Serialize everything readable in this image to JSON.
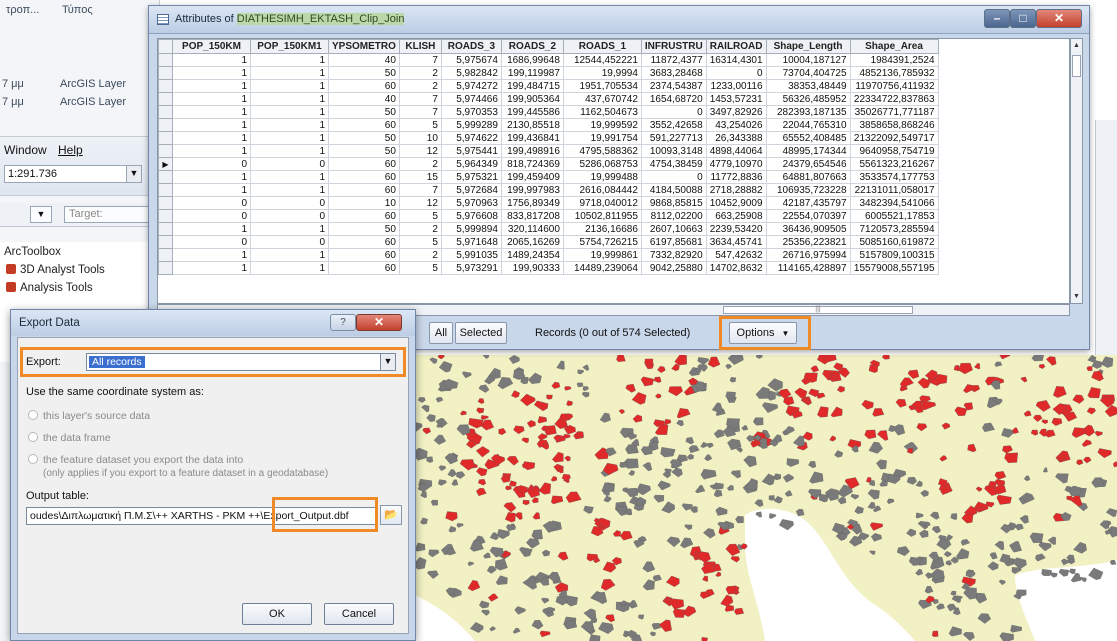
{
  "background_window": {
    "column_headers": [
      "τροπ...",
      "Τύπος"
    ],
    "layers": [
      {
        "size": "7 μμ",
        "type": "ArcGIS Layer"
      },
      {
        "size": "7 μμ",
        "type": "ArcGIS Layer"
      }
    ],
    "menu": {
      "window": "Window",
      "help": "Help"
    },
    "scale": "1:291.736",
    "target_label": "Target:",
    "arctoolbox": {
      "title": "ArcToolbox",
      "items": [
        "3D Analyst Tools",
        "Analysis Tools"
      ]
    }
  },
  "attribute_table": {
    "title_prefix": "Attributes of ",
    "title_highlight": "DIATHESIMH_EKTASH_Clip_Join",
    "columns": [
      "POP_150KM",
      "POP_150KM1",
      "YPSOMETRO",
      "KLISH",
      "ROADS_3",
      "ROADS_2",
      "ROADS_1",
      "INFRUSTRU",
      "RAILROAD",
      "Shape_Length",
      "Shape_Area"
    ],
    "rows": [
      [
        "1",
        "1",
        "40",
        "7",
        "5,975674",
        "1686,99648",
        "12544,452221",
        "11872,4377",
        "16314,4301",
        "10004,187127",
        "1984391,2524"
      ],
      [
        "1",
        "1",
        "50",
        "2",
        "5,982842",
        "199,119987",
        "19,9994",
        "3683,28468",
        "0",
        "73704,404725",
        "4852136,785932"
      ],
      [
        "1",
        "1",
        "60",
        "2",
        "5,974272",
        "199,484715",
        "1951,705534",
        "2374,54387",
        "1233,00116",
        "38353,48449",
        "11970756,411932"
      ],
      [
        "1",
        "1",
        "40",
        "7",
        "5,974466",
        "199,905364",
        "437,670742",
        "1654,68720",
        "1453,57231",
        "56326,485952",
        "22334722,837863"
      ],
      [
        "1",
        "1",
        "50",
        "7",
        "5,970353",
        "199,445586",
        "1162,504673",
        "0",
        "3497,82926",
        "282393,187135",
        "35026771,771187"
      ],
      [
        "1",
        "1",
        "60",
        "5",
        "5,999289",
        "2130,85518",
        "19,999592",
        "3552,42658",
        "43,254026",
        "22044,765310",
        "3858658,868246"
      ],
      [
        "1",
        "1",
        "50",
        "10",
        "5,974622",
        "199,436841",
        "19,991754",
        "591,227713",
        "26,343388",
        "65552,408485",
        "21322092,549717"
      ],
      [
        "1",
        "1",
        "50",
        "12",
        "5,975441",
        "199,498916",
        "4795,588362",
        "10093,3148",
        "4898,44064",
        "48995,174344",
        "9640958,754719"
      ],
      [
        "0",
        "0",
        "60",
        "2",
        "5,964349",
        "818,724369",
        "5286,068753",
        "4754,38459",
        "4779,10970",
        "24379,654546",
        "5561323,216267"
      ],
      [
        "1",
        "1",
        "60",
        "15",
        "5,975321",
        "199,459409",
        "19,999488",
        "0",
        "11772,8836",
        "64881,807663",
        "3533574,177753"
      ],
      [
        "1",
        "1",
        "60",
        "7",
        "5,972684",
        "199,997983",
        "2616,084442",
        "4184,50088",
        "2718,28882",
        "106935,723228",
        "22131011,058017"
      ],
      [
        "0",
        "0",
        "10",
        "12",
        "5,970963",
        "1756,89349",
        "9718,040012",
        "9868,85815",
        "10452,9009",
        "42187,435797",
        "3482394,541066"
      ],
      [
        "0",
        "0",
        "60",
        "5",
        "5,976608",
        "833,817208",
        "10502,811955",
        "8112,02200",
        "663,25908",
        "22554,070397",
        "6005521,17853"
      ],
      [
        "1",
        "1",
        "50",
        "2",
        "5,999894",
        "320,114600",
        "2136,16686",
        "2607,10663",
        "2239,53420",
        "36436,909505",
        "7120573,285594"
      ],
      [
        "0",
        "0",
        "60",
        "5",
        "5,971648",
        "2065,16269",
        "5754,726215",
        "6197,85681",
        "3634,45741",
        "25356,223821",
        "5085160,619872"
      ],
      [
        "1",
        "1",
        "60",
        "2",
        "5,991035",
        "1489,24354",
        "19,999861",
        "7332,82920",
        "547,42632",
        "26716,975994",
        "5157809,100315"
      ],
      [
        "1",
        "1",
        "60",
        "5",
        "5,973291",
        "199,90333",
        "14489,239064",
        "9042,25880",
        "14702,8632",
        "114165,428897",
        "15579008,557195"
      ]
    ],
    "buttons": {
      "all": "All",
      "selected": "Selected",
      "options": "Options"
    },
    "records_text": "Records (0 out of 574 Selected)"
  },
  "export_dialog": {
    "title": "Export Data",
    "export_label": "Export:",
    "export_value": "All records",
    "coordinate_label": "Use the same coordinate system as:",
    "radio_options": [
      "this layer's source data",
      "the data frame",
      "the feature dataset you export the data into"
    ],
    "radio_note": "(only applies if you export to a feature dataset in a geodatabase)",
    "output_label": "Output table:",
    "output_path_prefix": "oudes\\Διπλωματική Π.Μ.Σ\\++ XARTHS - PKM ++\\",
    "output_filename": "Export_Output.dbf",
    "ok_label": "OK",
    "cancel_label": "Cancel"
  },
  "colors": {
    "highlight": "#f08a26",
    "map_land": "#f1f1c4",
    "map_red": "#e02a2a",
    "map_gray": "#7a7a7a",
    "map_sea": "#ffffff"
  }
}
